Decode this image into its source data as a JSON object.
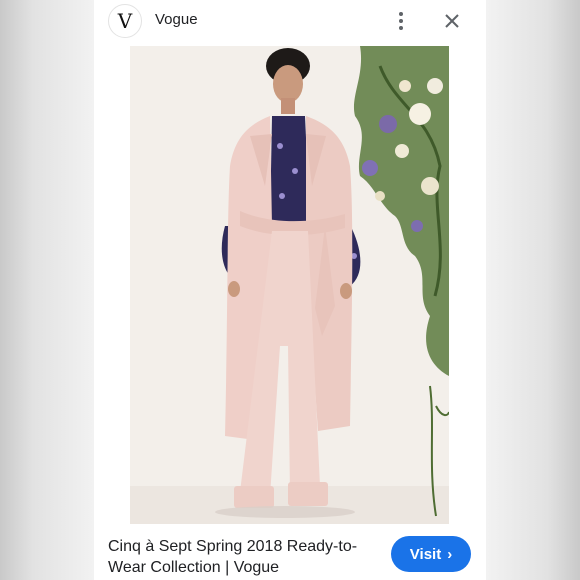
{
  "header": {
    "logo_letter": "V",
    "site_name": "Vogue",
    "menu_icon": "more-vert-icon",
    "close_icon": "close-icon"
  },
  "image": {
    "subject": "model in pale pink trench coat and wide-leg trousers with floral blouse, flowers behind"
  },
  "footer": {
    "caption": "Cinq à Sept Spring 2018 Ready-to-Wear Collection | Vogue",
    "visit_label": "Visit",
    "visit_icon": "chevron-right-icon"
  },
  "colors": {
    "accent": "#1a73e8",
    "background": "#f4f4f4",
    "coat": "#efcfc8",
    "blouse": "#2e2a5a"
  }
}
